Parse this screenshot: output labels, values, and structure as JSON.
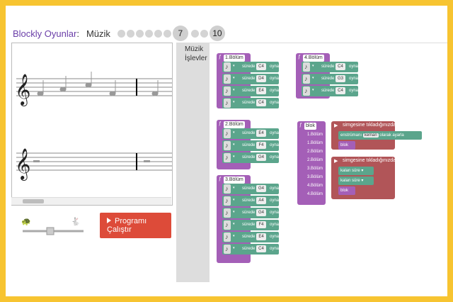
{
  "header": {
    "title": "Blockly Oyunlar",
    "sep": " : ",
    "game": "Müzik",
    "current_level": "7",
    "last_level": "10"
  },
  "run_button": {
    "label": "Programı Çalıştır"
  },
  "toolbox": {
    "category": "Müzik İşlevler"
  },
  "workspace": {
    "fn1": {
      "name": "1.Bölüm",
      "rows": [
        {
          "note": "C4"
        },
        {
          "note": "D4"
        },
        {
          "note": "E4"
        },
        {
          "note": "C4"
        }
      ]
    },
    "fn4": {
      "name": "4.Bölüm",
      "rows": [
        {
          "note": "C4"
        },
        {
          "note": "G3"
        },
        {
          "note": "C4"
        }
      ]
    },
    "fn2": {
      "name": "2.Bölüm",
      "rows": [
        {
          "note": "E4"
        },
        {
          "note": "F4"
        },
        {
          "note": "G4"
        }
      ]
    },
    "fn3": {
      "name": "3.Bölüm",
      "rows": [
        {
          "note": "G4"
        },
        {
          "note": "A4"
        },
        {
          "note": "G4"
        },
        {
          "note": "F4"
        },
        {
          "note": "E4"
        },
        {
          "note": "C4"
        }
      ]
    },
    "blok_def": {
      "name": "blok",
      "items": [
        "1.Bölüm",
        "1.Bölüm",
        "2.Bölüm",
        "2.Bölüm",
        "3.Bölüm",
        "3.Bölüm",
        "4.Bölüm",
        "4.Bölüm"
      ]
    },
    "labels": {
      "sure": "sürede",
      "oynat": "oynat"
    },
    "event1": {
      "title": "simgesine tıkladığınızda",
      "instrument_label": "enstrümanı",
      "instrument": "keman",
      "instrument_suffix": "olarak ayarla",
      "call": "blok"
    },
    "event2": {
      "title": "simgesine tıkladığınızda",
      "rest1": "kalan süre",
      "rest2": "kalan süre",
      "call": "blok"
    }
  }
}
